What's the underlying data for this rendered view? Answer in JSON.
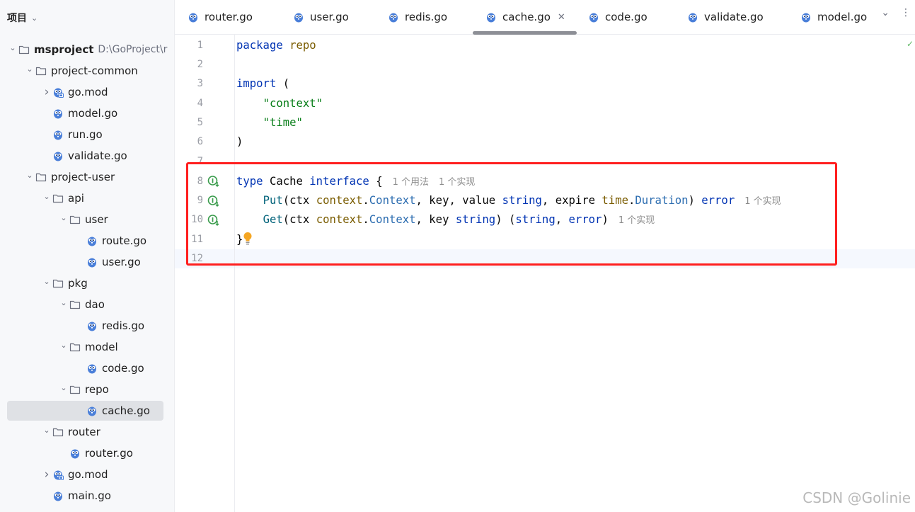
{
  "sidebar": {
    "title": "项目",
    "tree": [
      {
        "label": "msproject",
        "path": "D:\\GoProject\\r",
        "depth": 0,
        "arrow": "down",
        "icon": "folder-icon",
        "bold": true
      },
      {
        "label": "project-common",
        "depth": 1,
        "arrow": "down",
        "icon": "folder-icon"
      },
      {
        "label": "go.mod",
        "depth": 2,
        "arrow": "right",
        "icon": "go-mod-icon"
      },
      {
        "label": "model.go",
        "depth": 2,
        "arrow": "none",
        "icon": "go-file-icon"
      },
      {
        "label": "run.go",
        "depth": 2,
        "arrow": "none",
        "icon": "go-file-icon"
      },
      {
        "label": "validate.go",
        "depth": 2,
        "arrow": "none",
        "icon": "go-file-icon"
      },
      {
        "label": "project-user",
        "depth": 1,
        "arrow": "down",
        "icon": "folder-icon"
      },
      {
        "label": "api",
        "depth": 2,
        "arrow": "down",
        "icon": "folder-icon"
      },
      {
        "label": "user",
        "depth": 3,
        "arrow": "down",
        "icon": "folder-icon"
      },
      {
        "label": "route.go",
        "depth": 4,
        "arrow": "none",
        "icon": "go-file-icon"
      },
      {
        "label": "user.go",
        "depth": 4,
        "arrow": "none",
        "icon": "go-file-icon"
      },
      {
        "label": "pkg",
        "depth": 2,
        "arrow": "down",
        "icon": "folder-icon"
      },
      {
        "label": "dao",
        "depth": 3,
        "arrow": "down",
        "icon": "folder-icon"
      },
      {
        "label": "redis.go",
        "depth": 4,
        "arrow": "none",
        "icon": "go-file-icon"
      },
      {
        "label": "model",
        "depth": 3,
        "arrow": "down",
        "icon": "folder-icon"
      },
      {
        "label": "code.go",
        "depth": 4,
        "arrow": "none",
        "icon": "go-file-icon"
      },
      {
        "label": "repo",
        "depth": 3,
        "arrow": "down",
        "icon": "folder-icon"
      },
      {
        "label": "cache.go",
        "depth": 4,
        "arrow": "none",
        "icon": "go-file-icon",
        "selected": true
      },
      {
        "label": "router",
        "depth": 2,
        "arrow": "down",
        "icon": "folder-icon"
      },
      {
        "label": "router.go",
        "depth": 3,
        "arrow": "none",
        "icon": "go-file-icon"
      },
      {
        "label": "go.mod",
        "depth": 2,
        "arrow": "right",
        "icon": "go-mod-icon"
      },
      {
        "label": "main.go",
        "depth": 2,
        "arrow": "none",
        "icon": "go-file-icon"
      }
    ]
  },
  "tabs": [
    {
      "label": "router.go",
      "active": false
    },
    {
      "label": "user.go",
      "active": false
    },
    {
      "label": "redis.go",
      "active": false
    },
    {
      "label": "cache.go",
      "active": true
    },
    {
      "label": "code.go",
      "active": false
    },
    {
      "label": "validate.go",
      "active": false
    },
    {
      "label": "model.go",
      "active": false
    }
  ],
  "editor": {
    "line_numbers": [
      "1",
      "2",
      "3",
      "4",
      "5",
      "6",
      "7",
      "8",
      "9",
      "10",
      "11",
      "12"
    ],
    "code": {
      "l1": {
        "kw": "package",
        "name": "repo"
      },
      "l3": {
        "kw": "import",
        "paren": "("
      },
      "l4": "\"context\"",
      "l5": "\"time\"",
      "l6": ")",
      "l8": {
        "kw1": "type",
        "name": "Cache",
        "kw2": "interface",
        "brace": "{",
        "hint_usage": "1 个用法",
        "hint_impl": "1 个实现"
      },
      "l9": {
        "fn": "Put",
        "a1": "(ctx ",
        "p1": "context",
        "t1": "Context",
        "a2": ", key, value ",
        "t2": "string",
        "a3": ", expire ",
        "p2": "time",
        "t3": "Duration",
        "a4": ") ",
        "t4": "error",
        "hint_impl": "1 个实现"
      },
      "l10": {
        "fn": "Get",
        "a1": "(ctx ",
        "p1": "context",
        "t1": "Context",
        "a2": ", key ",
        "t2": "string",
        "a3": ") (",
        "t3": "string",
        "a4": ", ",
        "t4": "error",
        "a5": ")",
        "hint_impl": "1 个实现"
      },
      "l11": "}"
    }
  },
  "watermark": "CSDN @Golinie",
  "colors": {
    "keyword": "#0033b3",
    "string": "#067d17",
    "package": "#7a5c00",
    "type": "#2b6cb0",
    "highlight_box": "#ff1f1f",
    "go_icon": "#4a7fd9"
  }
}
